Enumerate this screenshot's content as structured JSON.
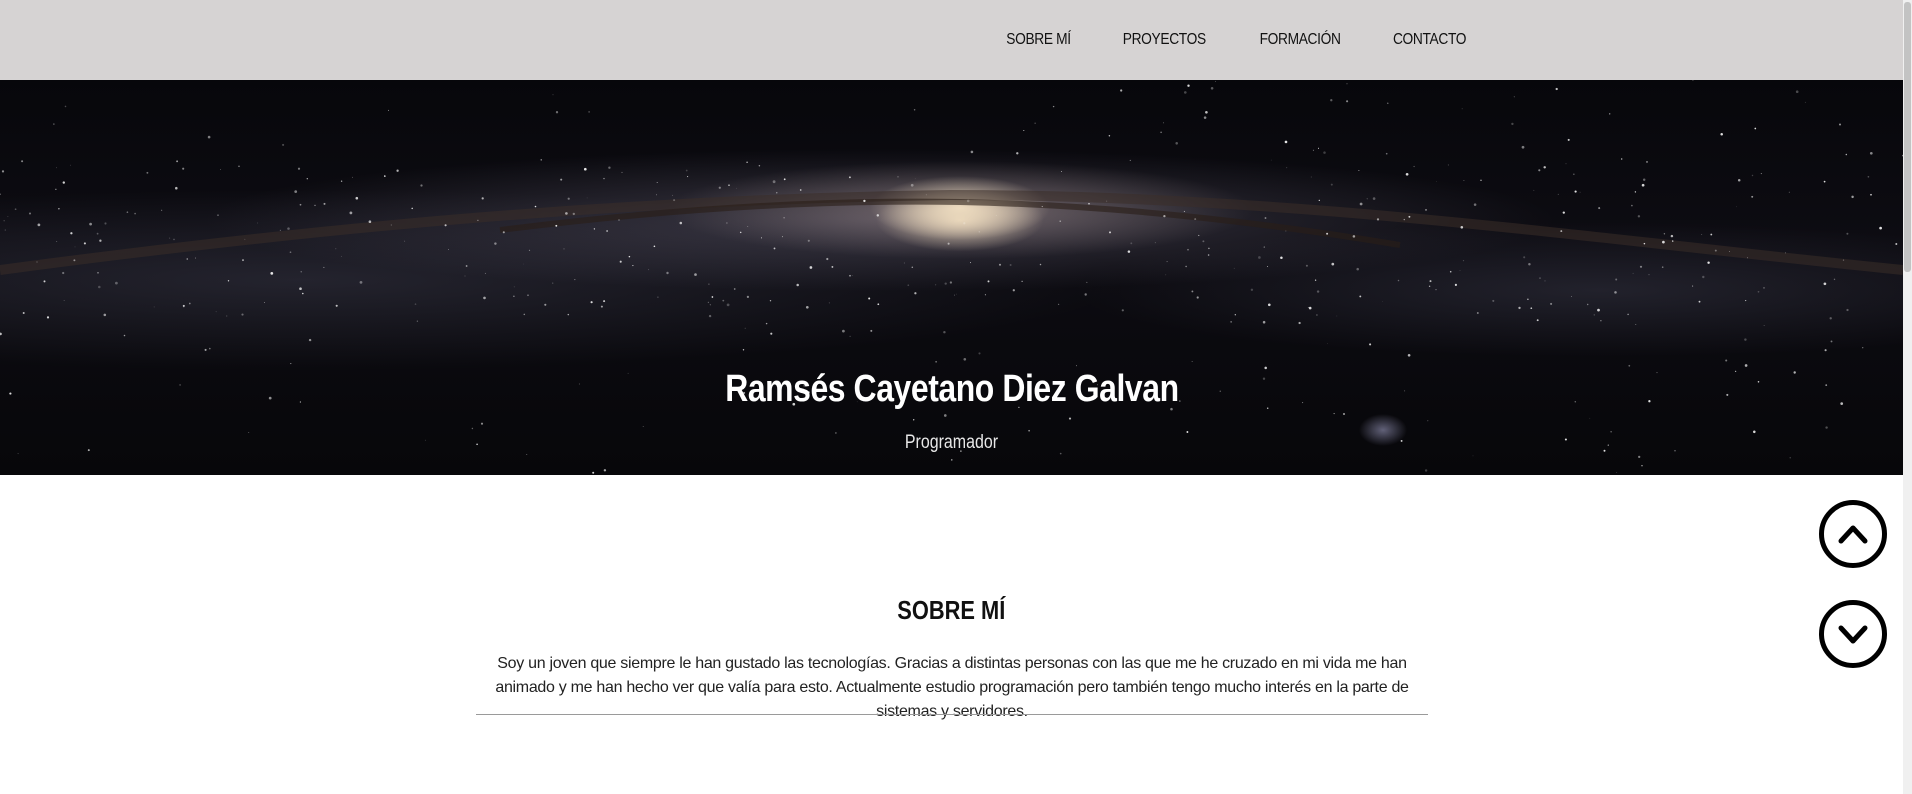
{
  "nav": {
    "items": [
      {
        "label": "SOBRE MÍ"
      },
      {
        "label": "PROYECTOS"
      },
      {
        "label": "FORMACIÓN"
      },
      {
        "label": "CONTACTO"
      }
    ]
  },
  "hero": {
    "name": "Ramsés Cayetano Diez Galvan",
    "role": "Programador"
  },
  "about": {
    "title": "SOBRE MÍ",
    "text": "Soy un joven que siempre le han gustado las tecnologías. Gracias a distintas personas con las que me he cruzado en mi vida me han animado y me han hecho ver que valía para esto. Actualmente estudio programación pero también tengo mucho interés en la parte de sistemas y servidores."
  },
  "controls": {
    "scroll_up_icon": "chevron-up-circle-icon",
    "scroll_down_icon": "chevron-down-circle-icon"
  },
  "colors": {
    "navbar_bg": "#d6d3d3",
    "hero_bg": "#0a0a0f",
    "text_dark": "#111111",
    "hero_text": "#ffffff"
  }
}
